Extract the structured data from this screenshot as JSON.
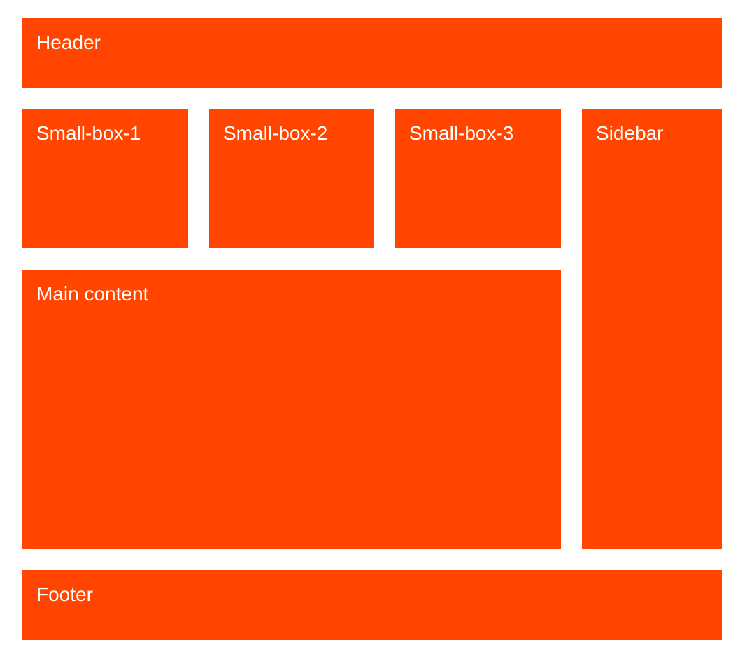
{
  "colors": {
    "box_background": "#FF4500",
    "text": "#FFFFFF",
    "page_background": "#FFFFFF"
  },
  "header": {
    "label": "Header"
  },
  "small_boxes": [
    {
      "label": "Small-box-1"
    },
    {
      "label": "Small-box-2"
    },
    {
      "label": "Small-box-3"
    }
  ],
  "sidebar": {
    "label": "Sidebar"
  },
  "main": {
    "label": "Main content"
  },
  "footer": {
    "label": "Footer"
  }
}
